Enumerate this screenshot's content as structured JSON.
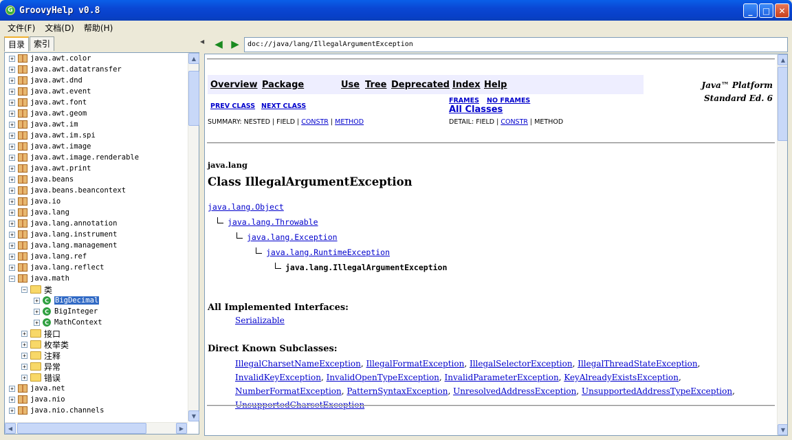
{
  "window": {
    "title": "GroovyHelp v0.8",
    "icon_letter": "G"
  },
  "menu": [
    "文件(F)",
    "文档(D)",
    "帮助(H)"
  ],
  "left_tabs": [
    "目录",
    "索引"
  ],
  "tree": {
    "packages_top": [
      "java.awt.color",
      "java.awt.datatransfer",
      "java.awt.dnd",
      "java.awt.event",
      "java.awt.font",
      "java.awt.geom",
      "java.awt.im",
      "java.awt.im.spi",
      "java.awt.image",
      "java.awt.image.renderable",
      "java.awt.print",
      "java.beans",
      "java.beans.beancontext",
      "java.io",
      "java.lang",
      "java.lang.annotation",
      "java.lang.instrument",
      "java.lang.management",
      "java.lang.ref",
      "java.lang.reflect"
    ],
    "open_package": "java.math",
    "classes_folder": "类",
    "classes": [
      "BigDecimal",
      "BigInteger",
      "MathContext"
    ],
    "class_icon_letter": "C",
    "folders": [
      "接口",
      "枚举类",
      "注释",
      "异常",
      "错误"
    ],
    "packages_bottom": [
      "java.net",
      "java.nio",
      "java.nio.channels"
    ]
  },
  "address": "doc://java/lang/IllegalArgumentException",
  "doc": {
    "nav": [
      "Overview",
      "Package",
      "Use",
      "Tree",
      "Deprecated",
      "Index",
      "Help"
    ],
    "platform_line1": "Java™ Platform",
    "platform_line2": "Standard Ed. 6",
    "prev_class": "PREV CLASS",
    "next_class": "NEXT CLASS",
    "frames": "FRAMES",
    "no_frames": "NO FRAMES",
    "all_classes": "All Classes",
    "summary_prefix": "SUMMARY: NESTED | FIELD | ",
    "summary_constr": "CONSTR",
    "summary_sep": " | ",
    "summary_method": "METHOD",
    "detail_prefix": "DETAIL: FIELD | ",
    "detail_constr": "CONSTR",
    "detail_suffix": " | METHOD",
    "package": "java.lang",
    "class_title": "Class IllegalArgumentException",
    "hierarchy": [
      "java.lang.Object",
      "java.lang.Throwable",
      "java.lang.Exception",
      "java.lang.RuntimeException",
      "java.lang.IllegalArgumentException"
    ],
    "implemented_heading": "All Implemented Interfaces:",
    "implemented": [
      "Serializable"
    ],
    "subclasses_heading": "Direct Known Subclasses:",
    "subclasses": [
      "IllegalCharsetNameException",
      "IllegalFormatException",
      "IllegalSelectorException",
      "IllegalThreadStateException",
      "InvalidKeyException",
      "InvalidOpenTypeException",
      "InvalidParameterException",
      "KeyAlreadyExistsException",
      "NumberFormatException",
      "PatternSyntaxException",
      "UnresolvedAddressException",
      "UnsupportedAddressTypeException",
      "UnsupportedCharsetException"
    ]
  }
}
